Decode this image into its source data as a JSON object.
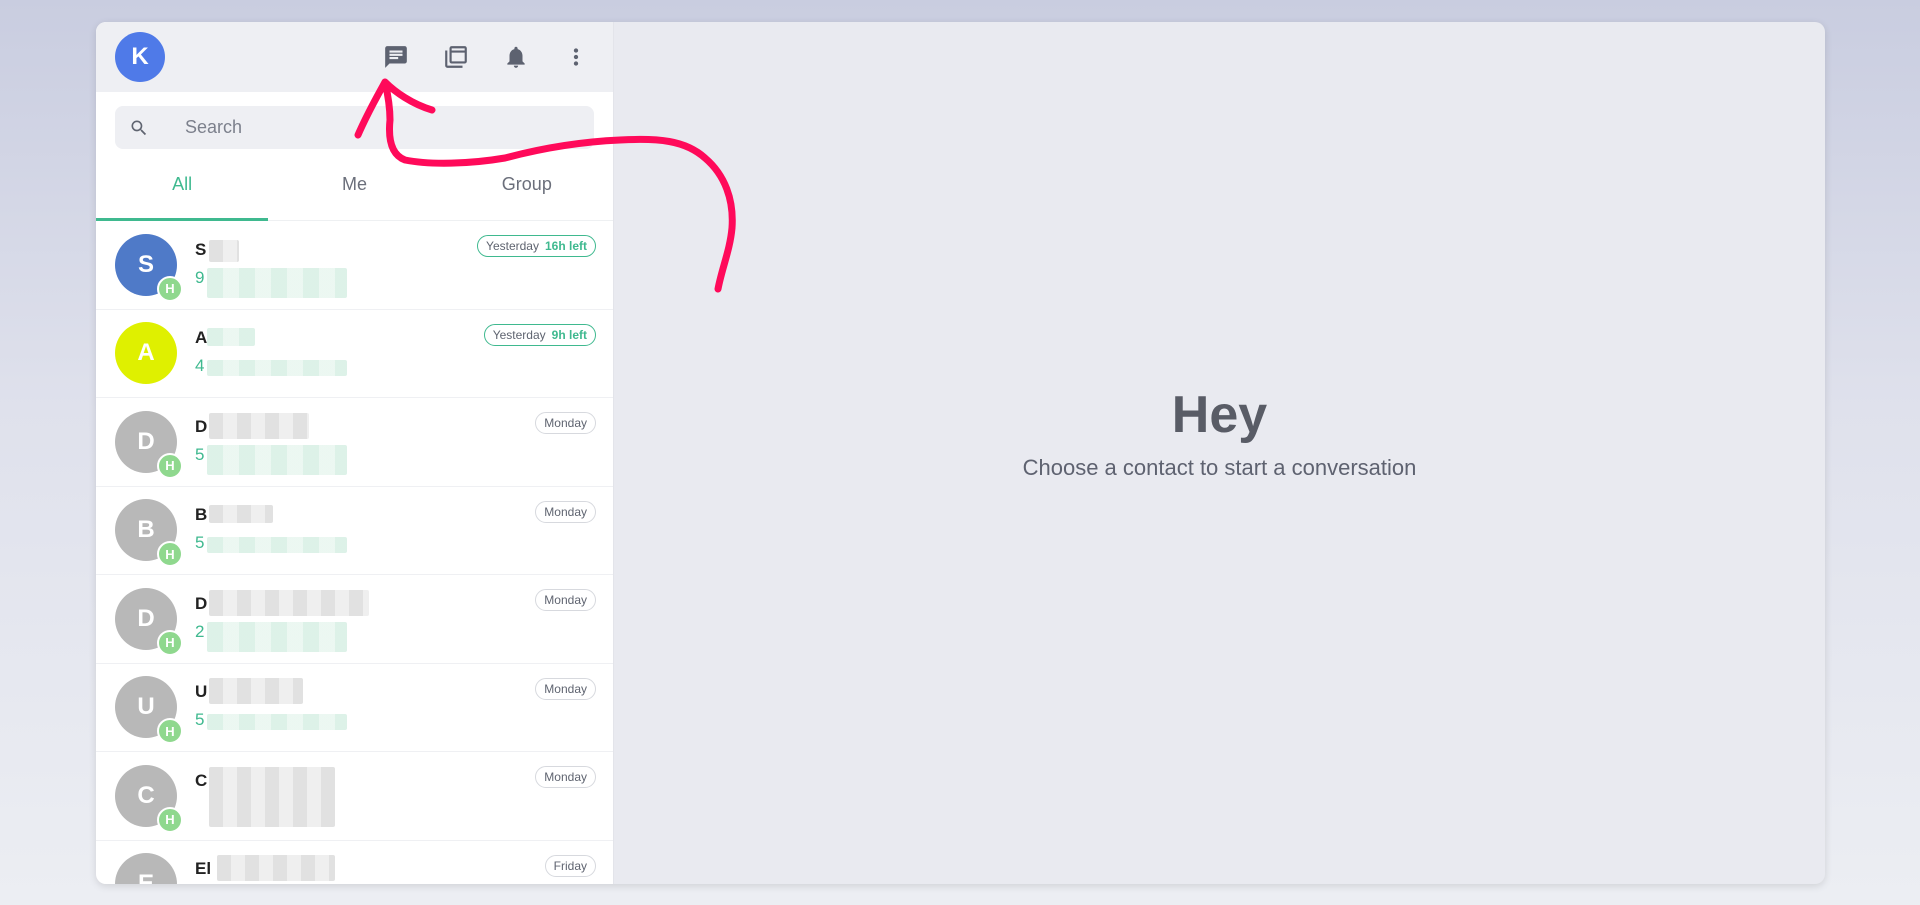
{
  "user": {
    "initial": "K"
  },
  "toolbar": {
    "icons": [
      "chat-icon",
      "library-icon",
      "bell-icon",
      "more-vert-icon"
    ]
  },
  "search": {
    "placeholder": "Search"
  },
  "tabs": [
    {
      "label": "All",
      "active": true
    },
    {
      "label": "Me",
      "active": false
    },
    {
      "label": "Group",
      "active": false
    }
  ],
  "contacts": [
    {
      "initial": "S",
      "color": "#4f7ac8",
      "name": "S",
      "preview": "9",
      "date": "Yesterday",
      "left": "16h left",
      "badge": "H"
    },
    {
      "initial": "A",
      "color": "#dff000",
      "name": "A",
      "preview": "4",
      "date": "Yesterday",
      "left": "9h left",
      "badge": ""
    },
    {
      "initial": "D",
      "color": "#b8b8b8",
      "name": "D",
      "preview": "5",
      "date": "Monday",
      "left": "",
      "badge": "H"
    },
    {
      "initial": "B",
      "color": "#b8b8b8",
      "name": "B",
      "preview": "5",
      "date": "Monday",
      "left": "",
      "badge": "H"
    },
    {
      "initial": "D",
      "color": "#b8b8b8",
      "name": "D",
      "preview": "2",
      "date": "Monday",
      "left": "",
      "badge": "H"
    },
    {
      "initial": "U",
      "color": "#b8b8b8",
      "name": "U",
      "preview": "5",
      "date": "Monday",
      "left": "",
      "badge": "H"
    },
    {
      "initial": "C",
      "color": "#b8b8b8",
      "name": "C",
      "preview": "",
      "date": "Monday",
      "left": "",
      "badge": "H"
    },
    {
      "initial": "E",
      "color": "#b8b8b8",
      "name": "El",
      "preview": "",
      "date": "Friday",
      "left": "",
      "badge": ""
    }
  ],
  "main": {
    "title": "Hey",
    "subtitle": "Choose a contact to start a conversation"
  },
  "colors": {
    "accent": "#3fb98f",
    "avatar_me": "#4f7ae8",
    "annotation": "#ff0a5a"
  }
}
